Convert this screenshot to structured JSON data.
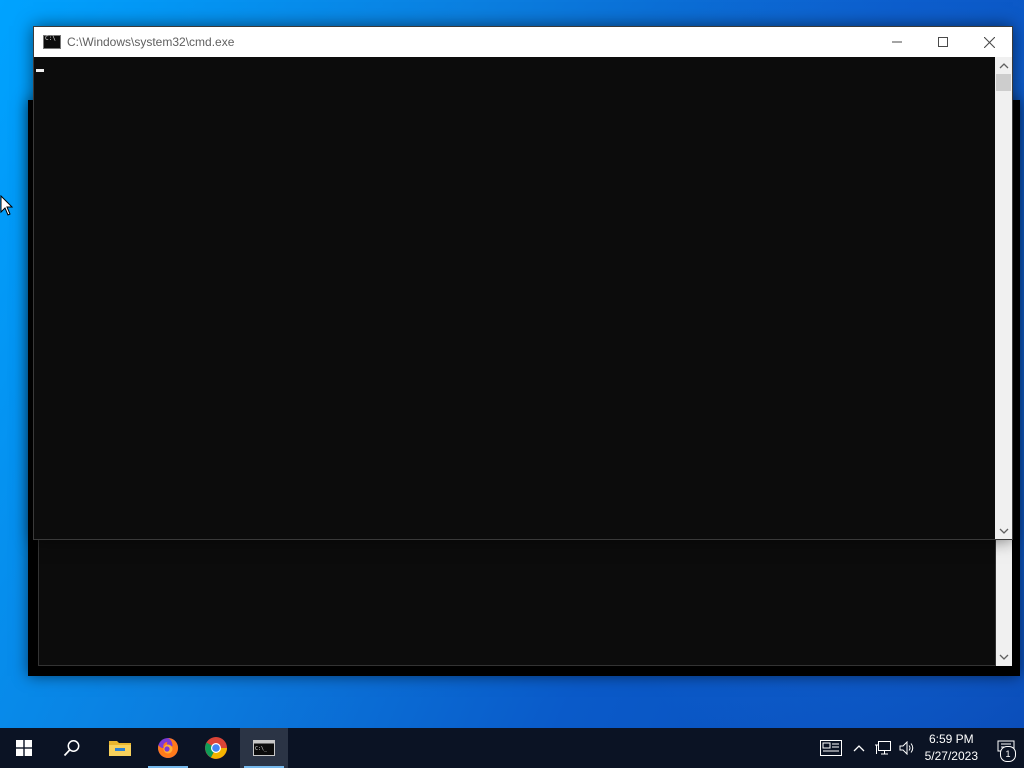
{
  "front_window": {
    "title": "C:\\Windows\\system32\\cmd.exe",
    "minimize_glyph": "—",
    "maximize_glyph": "☐",
    "close_glyph": "✕"
  },
  "taskbar": {
    "clock_time": "6:59 PM",
    "clock_date": "5/27/2023",
    "notification_count": "1",
    "items": [
      "Start",
      "Search",
      "File Explorer",
      "Firefox",
      "Google Chrome",
      "Command Prompt"
    ]
  },
  "colors": {
    "console_bg": "#0c0c0c",
    "taskbar_bg": "#0b1324",
    "accent": "#76b9ed"
  }
}
